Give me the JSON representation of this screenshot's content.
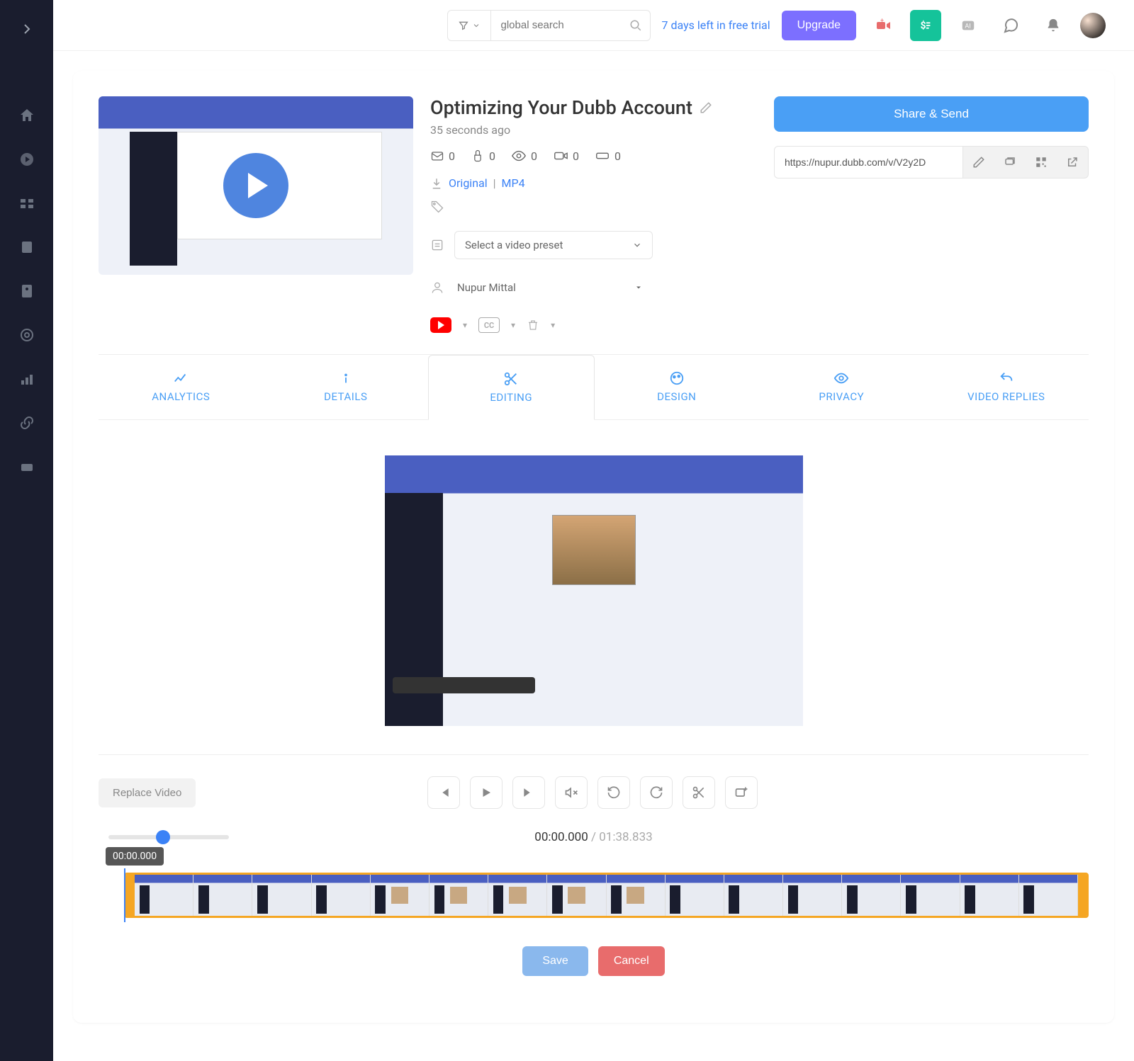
{
  "topbar": {
    "search_placeholder": "global search",
    "trial_text": "7 days left in free trial",
    "upgrade": "Upgrade"
  },
  "video": {
    "title": "Optimizing Your Dubb Account",
    "timeago": "35 seconds ago",
    "stats": {
      "emails": "0",
      "clicks": "0",
      "views": "0",
      "watch": "0",
      "cta": "0"
    },
    "download": {
      "original": "Original",
      "sep": "|",
      "mp4": "MP4"
    },
    "preset_placeholder": "Select a video preset",
    "owner": "Nupur Mittal",
    "cc_label": "CC"
  },
  "share": {
    "button": "Share & Send",
    "url": "https://nupur.dubb.com/v/V2y2D"
  },
  "tabs": {
    "analytics": "ANALYTICS",
    "details": "DETAILS",
    "editing": "EDITING",
    "design": "DESIGN",
    "privacy": "PRIVACY",
    "replies": "VIDEO REPLIES"
  },
  "editor": {
    "replace": "Replace Video",
    "time_current": "00:00.000",
    "time_sep": " / ",
    "time_total": "01:38.833",
    "tooltip": "00:00.000",
    "save": "Save",
    "cancel": "Cancel"
  }
}
